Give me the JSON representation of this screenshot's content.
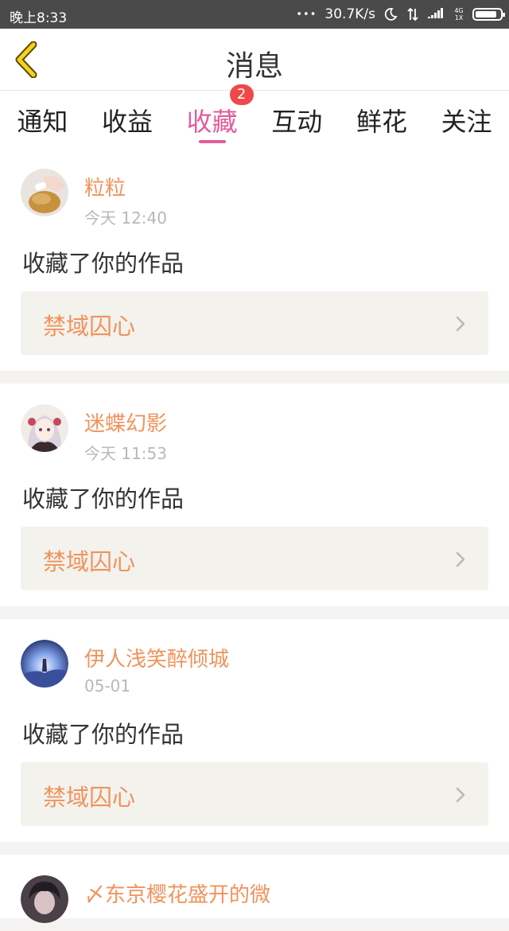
{
  "status_bar": {
    "time": "晚上8:33",
    "dots": "•••",
    "network_speed": "30.7K/s",
    "signal_label_top": "4G",
    "signal_label_bottom": "1X",
    "battery_level": 0.85
  },
  "header": {
    "title": "消息",
    "back_icon": "chevron-left-icon"
  },
  "tabs": [
    {
      "label": "通知",
      "active": false
    },
    {
      "label": "收益",
      "active": false
    },
    {
      "label": "收藏",
      "active": true,
      "badge": "2"
    },
    {
      "label": "互动",
      "active": false
    },
    {
      "label": "鲜花",
      "active": false
    },
    {
      "label": "关注",
      "active": false
    }
  ],
  "colors": {
    "accent_pink": "#e05c9a",
    "name_orange": "#f0935b",
    "badge_red": "#f04848"
  },
  "messages": [
    {
      "user": "粒粒",
      "time": "今天 12:40",
      "text": "收藏了你的作品",
      "work": "禁域囚心"
    },
    {
      "user": "迷蝶幻影",
      "time": "今天 11:53",
      "text": "收藏了你的作品",
      "work": "禁域囚心"
    },
    {
      "user": "伊人浅笑醉倾城",
      "time": "05-01",
      "text": "收藏了你的作品",
      "work": "禁域囚心"
    },
    {
      "user": "〆东京樱花盛开的微"
    }
  ]
}
